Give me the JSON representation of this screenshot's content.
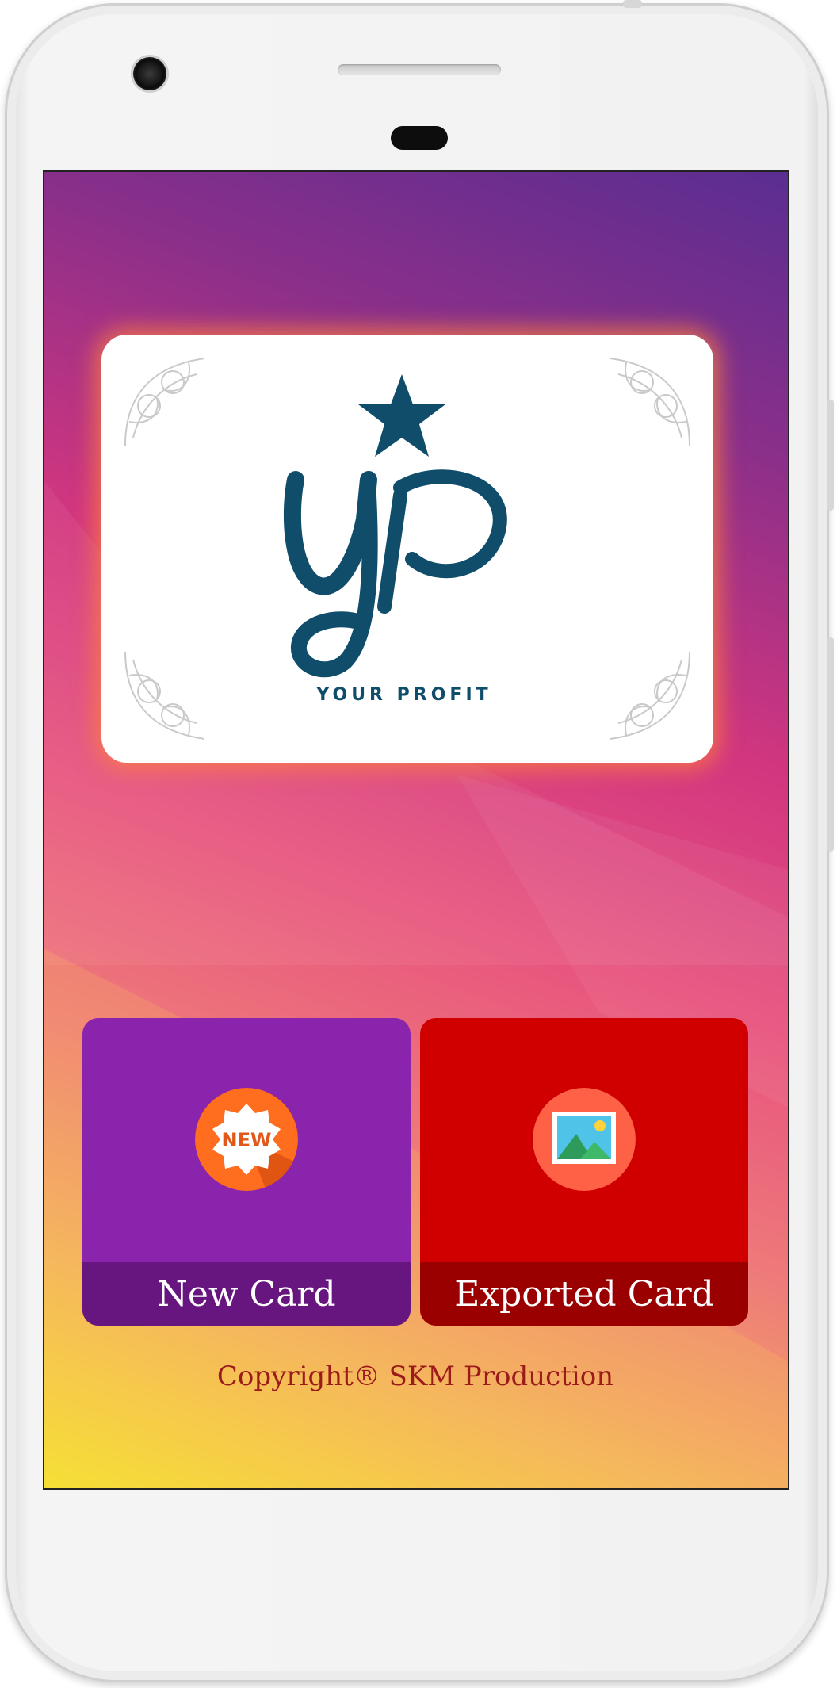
{
  "card": {
    "logo_text": "YOUR PROFIT",
    "logo_letters": "YP",
    "colors": {
      "logo": "#0f4d6b",
      "glow": "#ff8a3c"
    }
  },
  "tiles": [
    {
      "label": "New Card",
      "icon": "new-badge-icon",
      "icon_text": "NEW",
      "color": "#8b24ad",
      "bar_color": "#67167f"
    },
    {
      "label": "Exported Card",
      "icon": "image-gallery-icon",
      "color": "#d10000",
      "bar_color": "#9a0000"
    }
  ],
  "footer": {
    "copyright": "Copyright® SKM Production"
  }
}
